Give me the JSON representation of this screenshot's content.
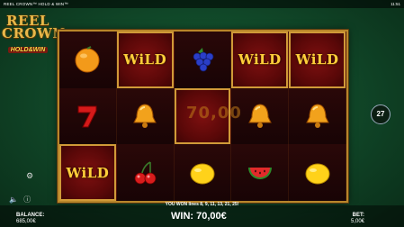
{
  "topbar": {
    "title": "REEL CROWN™ HOLD & WIN™",
    "clock": "11:51"
  },
  "logo": {
    "line1": "REEL",
    "line2": "CROWN",
    "line3": "HOLD&WIN"
  },
  "reels": {
    "wild_label": "WiLD",
    "rows": [
      [
        "orange",
        "wild",
        "grapes",
        "wild",
        "wild"
      ],
      [
        "seven",
        "bell",
        "empty",
        "bell",
        "bell"
      ],
      [
        "wild",
        "cherries",
        "lemon",
        "watermelon",
        "lemon"
      ]
    ],
    "highlighted": [
      [
        false,
        true,
        false,
        true,
        true
      ],
      [
        false,
        false,
        true,
        false,
        false
      ],
      [
        true,
        false,
        false,
        false,
        false
      ]
    ]
  },
  "win_overlay": "70,00",
  "ways_count": "27",
  "message": "YOU WON lines 8, 9, 11, 13, 21, 25!",
  "balance": {
    "label": "BALANCE:",
    "value": "685,00€"
  },
  "win": {
    "label": "WIN: 70,00€"
  },
  "bet": {
    "label": "BET:",
    "value": "5,00€"
  },
  "colors": {
    "gold": "#e8b84a",
    "frame_red": "#7e1010",
    "table_green": "#1b6a3b"
  }
}
